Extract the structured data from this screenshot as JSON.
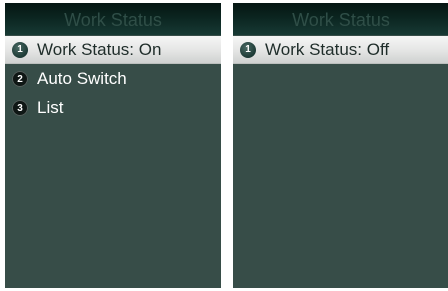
{
  "left_screen": {
    "title": "Work Status",
    "items": [
      {
        "number": "1",
        "label": "Work Status: On",
        "selected": true
      },
      {
        "number": "2",
        "label": "Auto Switch",
        "selected": false
      },
      {
        "number": "3",
        "label": "List",
        "selected": false
      }
    ]
  },
  "right_screen": {
    "title": "Work Status",
    "items": [
      {
        "number": "1",
        "label": "Work Status: Off",
        "selected": true
      }
    ]
  },
  "colors": {
    "screen_background": "#374d48",
    "title_bar": "#0b2520",
    "title_text": "#2f4e47",
    "selected_background": "#e4e5e4",
    "item_text": "#ffffff"
  }
}
